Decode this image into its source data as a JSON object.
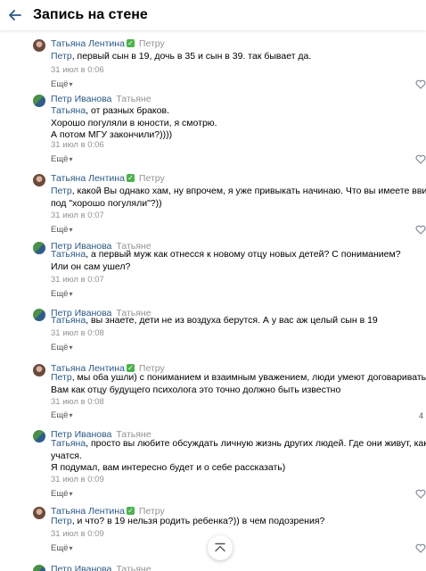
{
  "header": {
    "title": "Запись на стене"
  },
  "comments": [
    {
      "author": "Татьяна Лентина",
      "verified": true,
      "reply_to": "Петру",
      "avatar": "female",
      "mention": "Петр",
      "lines": [
        ", первый сын в 19, дочь в 35 и сын в 39. так бывает да."
      ],
      "date": "31 июл в 0:06",
      "more": "Ещё"
    },
    {
      "author": "Петр Иванова",
      "verified": false,
      "reply_to": "Татьяне",
      "avatar": "male",
      "mention": "Татьяна",
      "lines": [
        ", от разных браков.",
        "Хорошо погуляли в юности, я смотрю.",
        "А потом МГУ закончили?))))"
      ],
      "date": "31 июл в 0:06",
      "more": "Ещё"
    },
    {
      "author": "Татьяна Лентина",
      "verified": true,
      "reply_to": "Петру",
      "avatar": "female",
      "mention": "Петр",
      "lines": [
        ", какой Вы однако хам, ну впрочем, я уже привыкать начинаю. Что вы имеете ввиду",
        "под \"хорошо погуляли\"?))"
      ],
      "date": "31 июл в 0:07",
      "more": "Ещё"
    },
    {
      "author": "Петр Иванова",
      "verified": false,
      "reply_to": "Татьяне",
      "avatar": "male",
      "mention": "Татьяна",
      "lines": [
        ", а первый муж как отнесся к новому отцу новых детей? С пониманием?",
        "Или он сам ушел?"
      ],
      "date": "31 июл в 0:07",
      "more": "Ещё"
    },
    {
      "author": "Петр Иванова",
      "verified": false,
      "reply_to": "Татьяне",
      "avatar": "male",
      "mention": "Татьяна",
      "lines": [
        ", вы знаете, дети не из воздуха берутся. А у вас аж целый сын в 19"
      ],
      "date": "31 июл в 0:08",
      "more": "Ещё"
    },
    {
      "author": "Татьяна Лентина",
      "verified": true,
      "reply_to": "Петру",
      "avatar": "female",
      "mention": "Петр",
      "lines": [
        ", мы оба ушли) с пониманием и взаимным уважением, люди умеют договариваться",
        "Вам как отцу будущего психолога это точно должно быть известно"
      ],
      "date": "31 июл в 0:08",
      "more": "Ещё",
      "like_count": "4"
    },
    {
      "author": "Петр Иванова",
      "verified": false,
      "reply_to": "Татьяне",
      "avatar": "male",
      "mention": "Татьяна",
      "lines": [
        ", просто вы любите обсуждать личную жизнь других людей. Где они живут, как",
        "учатся.",
        "Я подумал, вам интересно будет и о себе рассказать)"
      ],
      "date": "31 июл в 0:09",
      "more": "Ещё"
    },
    {
      "author": "Татьяна Лентина",
      "verified": true,
      "reply_to": "Петру",
      "avatar": "female",
      "mention": "Петр",
      "lines": [
        ", и что? в 19 нельзя родить ребенка?)) в чем подозрения?"
      ],
      "date": "31 июл в 0:09",
      "more": "Ещё"
    },
    {
      "author": "Петр Иванова",
      "verified": false,
      "reply_to": "Татьяне",
      "avatar": "male",
      "mention": "",
      "lines": [],
      "date": "",
      "more": ""
    }
  ]
}
